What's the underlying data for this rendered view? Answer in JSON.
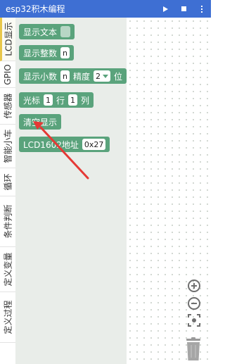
{
  "app": {
    "title": "esp32积木编程",
    "actions": [
      {
        "name": "run-icon"
      },
      {
        "name": "stop-icon"
      },
      {
        "name": "more-icon"
      }
    ]
  },
  "categories": [
    "LCD显示",
    "GPIO",
    "传感器",
    "智能小车",
    "循环",
    "条件判断",
    "定义变量",
    "定义过程"
  ],
  "active_category": "LCD显示",
  "blocks": {
    "show_text": {
      "label": "显示文本"
    },
    "show_int": {
      "label": "显示整数",
      "slot": "n"
    },
    "show_decimal": {
      "label": "显示小数",
      "slot": "n",
      "precision_label": "精度",
      "precision_value": "2",
      "unit": "位"
    },
    "cursor": {
      "label": "光标",
      "row_value": "1",
      "row_label": "行",
      "col_value": "1",
      "col_label": "列"
    },
    "clear": {
      "label": "清空显示"
    },
    "lcd_addr": {
      "label": "LCD1602地址",
      "value": "0x27"
    }
  },
  "workspace_controls": [
    "zoom-in-icon",
    "zoom-out-icon",
    "recenter-icon",
    "trash-icon"
  ],
  "colors": {
    "appbar": "#3e6fd3",
    "block": "#5aa37c",
    "flyout": "#e9ede9",
    "tab_accent": "#e8c74a",
    "arrow": "#e53935"
  }
}
